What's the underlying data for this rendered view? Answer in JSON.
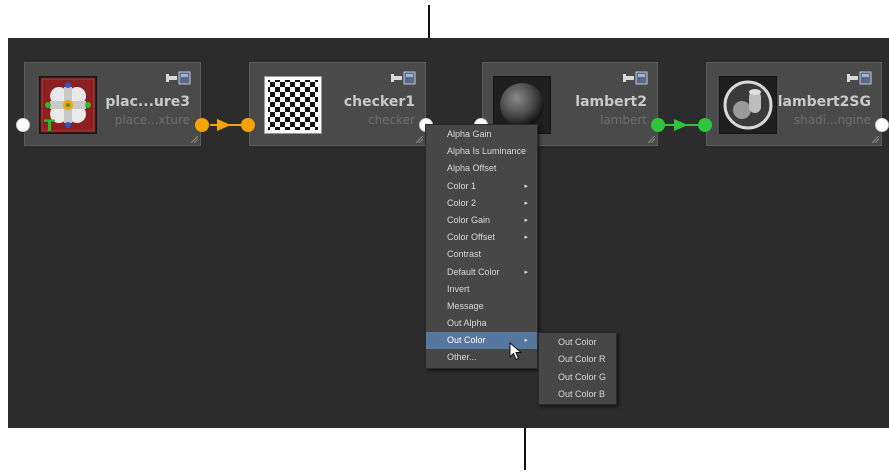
{
  "nodes": [
    {
      "name": "plac...ure3",
      "type": "place...xture",
      "icon": "place2dTexture-icon"
    },
    {
      "name": "checker1",
      "type": "checker",
      "icon": "checker-texture-icon"
    },
    {
      "name": "lambert2",
      "type": "lambert",
      "icon": "lambert-sphere-icon"
    },
    {
      "name": "lambert2SG",
      "type": "shadi...ngine",
      "icon": "shading-engine-icon"
    }
  ],
  "connections": [
    {
      "color": "#f5a300"
    },
    {
      "color": "#2fc43b"
    }
  ],
  "context_menu": {
    "items": [
      {
        "label": "Alpha Gain",
        "submenu": false
      },
      {
        "label": "Alpha Is Luminance",
        "submenu": false
      },
      {
        "label": "Alpha Offset",
        "submenu": false
      },
      {
        "label": "Color 1",
        "submenu": true
      },
      {
        "label": "Color 2",
        "submenu": true
      },
      {
        "label": "Color Gain",
        "submenu": true
      },
      {
        "label": "Color Offset",
        "submenu": true
      },
      {
        "label": "Contrast",
        "submenu": false
      },
      {
        "label": "Default Color",
        "submenu": true
      },
      {
        "label": "Invert",
        "submenu": false
      },
      {
        "label": "Message",
        "submenu": false
      },
      {
        "label": "Out Alpha",
        "submenu": false
      },
      {
        "label": "Out Color",
        "submenu": true,
        "highlighted": true
      },
      {
        "label": "Other...",
        "submenu": false
      }
    ],
    "arrow_glyph": "▸"
  },
  "submenu": {
    "items": [
      "Out Color",
      "Out Color R",
      "Out Color G",
      "Out Color B"
    ]
  },
  "colors": {
    "editor_bg": "#2c2c2c",
    "node_bg": "#4a4a4a",
    "highlight": "#5678a0",
    "orange_port": "#f5a300",
    "green_port": "#2fc43b"
  }
}
